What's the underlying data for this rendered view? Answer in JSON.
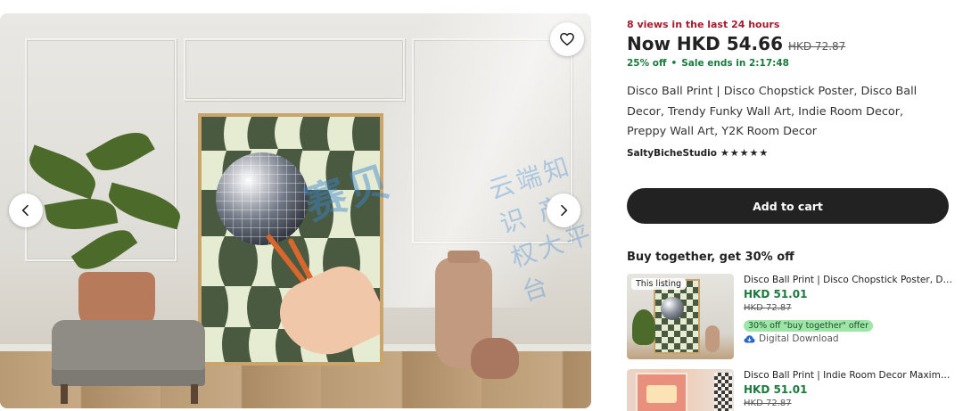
{
  "gallery": {
    "favorite_icon": "heart-outline-icon",
    "prev_icon": "chevron-left-icon",
    "next_icon": "chevron-right-icon",
    "watermark_main": "赛贝",
    "watermark_side": "云端知识 产权大平台"
  },
  "listing": {
    "views_note": "8 views in the last 24 hours",
    "price_now": "Now HKD 54.66",
    "price_original": "HKD 72.87",
    "discount": "25% off",
    "separator": "•",
    "sale_countdown": "Sale ends in 2:17:48",
    "title": "Disco Ball Print | Disco Chopstick Poster, Disco Ball Decor, Trendy Funky Wall Art, Indie Room Decor, Preppy Wall Art, Y2K Room Decor",
    "shop_name": "SaltyBicheStudio",
    "rating_stars": "★★★★★",
    "add_to_cart_label": "Add to cart"
  },
  "buy_together": {
    "heading": "Buy together, get 30% off",
    "items": [
      {
        "tag": "This listing",
        "name": "Disco Ball Print | Disco Chopstick Poster, Disco Ball Decor",
        "price": "HKD 51.01",
        "original_price": "HKD 72.87",
        "badge": "30% off \"buy together\" offer",
        "delivery": "Digital Download",
        "delivery_icon": "cloud-download-icon"
      },
      {
        "name": "Disco Ball Print | Indie Room Decor Maximalist Wall Art",
        "price": "HKD 51.01",
        "original_price": "HKD 72.87"
      }
    ]
  },
  "colors": {
    "urgency": "#a61a2e",
    "sale_green": "#1a7a3c",
    "button_dark": "#222222",
    "badge_green": "#9ee6a8"
  }
}
